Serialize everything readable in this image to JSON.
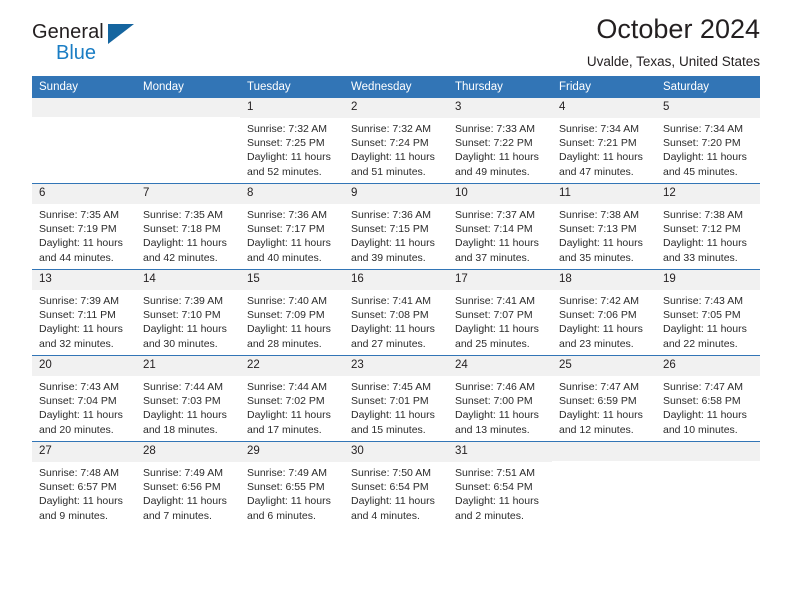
{
  "brand": {
    "name_top": "General",
    "name_bottom": "Blue",
    "triangle_color": "#15659f",
    "blue_color": "#1a7dc4"
  },
  "header": {
    "title": "October 2024",
    "subtitle": "Uvalde, Texas, United States"
  },
  "theme": {
    "header_blue": "#3275b6",
    "daynum_bg": "#f1f1f1",
    "text": "#231f20"
  },
  "weekday_headers": [
    "Sunday",
    "Monday",
    "Tuesday",
    "Wednesday",
    "Thursday",
    "Friday",
    "Saturday"
  ],
  "weeks": [
    [
      {
        "day": "",
        "sunrise": "",
        "sunset": "",
        "daylight": ""
      },
      {
        "day": "",
        "sunrise": "",
        "sunset": "",
        "daylight": ""
      },
      {
        "day": "1",
        "sunrise": "Sunrise: 7:32 AM",
        "sunset": "Sunset: 7:25 PM",
        "daylight": "Daylight: 11 hours and 52 minutes."
      },
      {
        "day": "2",
        "sunrise": "Sunrise: 7:32 AM",
        "sunset": "Sunset: 7:24 PM",
        "daylight": "Daylight: 11 hours and 51 minutes."
      },
      {
        "day": "3",
        "sunrise": "Sunrise: 7:33 AM",
        "sunset": "Sunset: 7:22 PM",
        "daylight": "Daylight: 11 hours and 49 minutes."
      },
      {
        "day": "4",
        "sunrise": "Sunrise: 7:34 AM",
        "sunset": "Sunset: 7:21 PM",
        "daylight": "Daylight: 11 hours and 47 minutes."
      },
      {
        "day": "5",
        "sunrise": "Sunrise: 7:34 AM",
        "sunset": "Sunset: 7:20 PM",
        "daylight": "Daylight: 11 hours and 45 minutes."
      }
    ],
    [
      {
        "day": "6",
        "sunrise": "Sunrise: 7:35 AM",
        "sunset": "Sunset: 7:19 PM",
        "daylight": "Daylight: 11 hours and 44 minutes."
      },
      {
        "day": "7",
        "sunrise": "Sunrise: 7:35 AM",
        "sunset": "Sunset: 7:18 PM",
        "daylight": "Daylight: 11 hours and 42 minutes."
      },
      {
        "day": "8",
        "sunrise": "Sunrise: 7:36 AM",
        "sunset": "Sunset: 7:17 PM",
        "daylight": "Daylight: 11 hours and 40 minutes."
      },
      {
        "day": "9",
        "sunrise": "Sunrise: 7:36 AM",
        "sunset": "Sunset: 7:15 PM",
        "daylight": "Daylight: 11 hours and 39 minutes."
      },
      {
        "day": "10",
        "sunrise": "Sunrise: 7:37 AM",
        "sunset": "Sunset: 7:14 PM",
        "daylight": "Daylight: 11 hours and 37 minutes."
      },
      {
        "day": "11",
        "sunrise": "Sunrise: 7:38 AM",
        "sunset": "Sunset: 7:13 PM",
        "daylight": "Daylight: 11 hours and 35 minutes."
      },
      {
        "day": "12",
        "sunrise": "Sunrise: 7:38 AM",
        "sunset": "Sunset: 7:12 PM",
        "daylight": "Daylight: 11 hours and 33 minutes."
      }
    ],
    [
      {
        "day": "13",
        "sunrise": "Sunrise: 7:39 AM",
        "sunset": "Sunset: 7:11 PM",
        "daylight": "Daylight: 11 hours and 32 minutes."
      },
      {
        "day": "14",
        "sunrise": "Sunrise: 7:39 AM",
        "sunset": "Sunset: 7:10 PM",
        "daylight": "Daylight: 11 hours and 30 minutes."
      },
      {
        "day": "15",
        "sunrise": "Sunrise: 7:40 AM",
        "sunset": "Sunset: 7:09 PM",
        "daylight": "Daylight: 11 hours and 28 minutes."
      },
      {
        "day": "16",
        "sunrise": "Sunrise: 7:41 AM",
        "sunset": "Sunset: 7:08 PM",
        "daylight": "Daylight: 11 hours and 27 minutes."
      },
      {
        "day": "17",
        "sunrise": "Sunrise: 7:41 AM",
        "sunset": "Sunset: 7:07 PM",
        "daylight": "Daylight: 11 hours and 25 minutes."
      },
      {
        "day": "18",
        "sunrise": "Sunrise: 7:42 AM",
        "sunset": "Sunset: 7:06 PM",
        "daylight": "Daylight: 11 hours and 23 minutes."
      },
      {
        "day": "19",
        "sunrise": "Sunrise: 7:43 AM",
        "sunset": "Sunset: 7:05 PM",
        "daylight": "Daylight: 11 hours and 22 minutes."
      }
    ],
    [
      {
        "day": "20",
        "sunrise": "Sunrise: 7:43 AM",
        "sunset": "Sunset: 7:04 PM",
        "daylight": "Daylight: 11 hours and 20 minutes."
      },
      {
        "day": "21",
        "sunrise": "Sunrise: 7:44 AM",
        "sunset": "Sunset: 7:03 PM",
        "daylight": "Daylight: 11 hours and 18 minutes."
      },
      {
        "day": "22",
        "sunrise": "Sunrise: 7:44 AM",
        "sunset": "Sunset: 7:02 PM",
        "daylight": "Daylight: 11 hours and 17 minutes."
      },
      {
        "day": "23",
        "sunrise": "Sunrise: 7:45 AM",
        "sunset": "Sunset: 7:01 PM",
        "daylight": "Daylight: 11 hours and 15 minutes."
      },
      {
        "day": "24",
        "sunrise": "Sunrise: 7:46 AM",
        "sunset": "Sunset: 7:00 PM",
        "daylight": "Daylight: 11 hours and 13 minutes."
      },
      {
        "day": "25",
        "sunrise": "Sunrise: 7:47 AM",
        "sunset": "Sunset: 6:59 PM",
        "daylight": "Daylight: 11 hours and 12 minutes."
      },
      {
        "day": "26",
        "sunrise": "Sunrise: 7:47 AM",
        "sunset": "Sunset: 6:58 PM",
        "daylight": "Daylight: 11 hours and 10 minutes."
      }
    ],
    [
      {
        "day": "27",
        "sunrise": "Sunrise: 7:48 AM",
        "sunset": "Sunset: 6:57 PM",
        "daylight": "Daylight: 11 hours and 9 minutes."
      },
      {
        "day": "28",
        "sunrise": "Sunrise: 7:49 AM",
        "sunset": "Sunset: 6:56 PM",
        "daylight": "Daylight: 11 hours and 7 minutes."
      },
      {
        "day": "29",
        "sunrise": "Sunrise: 7:49 AM",
        "sunset": "Sunset: 6:55 PM",
        "daylight": "Daylight: 11 hours and 6 minutes."
      },
      {
        "day": "30",
        "sunrise": "Sunrise: 7:50 AM",
        "sunset": "Sunset: 6:54 PM",
        "daylight": "Daylight: 11 hours and 4 minutes."
      },
      {
        "day": "31",
        "sunrise": "Sunrise: 7:51 AM",
        "sunset": "Sunset: 6:54 PM",
        "daylight": "Daylight: 11 hours and 2 minutes."
      },
      {
        "day": "",
        "sunrise": "",
        "sunset": "",
        "daylight": ""
      },
      {
        "day": "",
        "sunrise": "",
        "sunset": "",
        "daylight": ""
      }
    ]
  ]
}
